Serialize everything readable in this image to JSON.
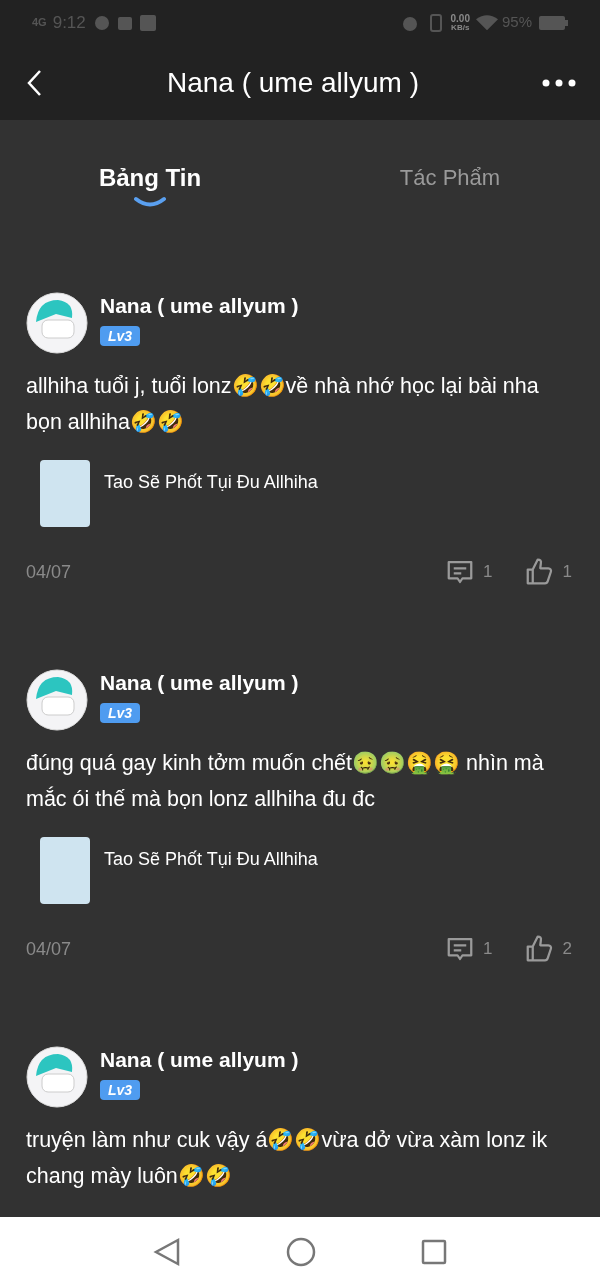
{
  "status_bar": {
    "network": "4G",
    "time": "9:12",
    "speed": "0.00",
    "speed_unit": "KB/s",
    "battery": "95%"
  },
  "header": {
    "title": "Nana ( ume allyum )"
  },
  "tabs": [
    {
      "label": "Bảng Tin",
      "selected": true
    },
    {
      "label": "Tác Phẩm",
      "selected": false
    }
  ],
  "posts": [
    {
      "author": "Nana ( ume allyum )",
      "level": "Lv3",
      "text": "allhiha tuổi j, tuổi lonz🤣🤣về nhà nhớ học lại bài nha bọn allhiha🤣🤣",
      "book": {
        "title": "Tao Sẽ Phốt Tụi Đu Allhiha"
      },
      "date": "04/07",
      "comments": "1",
      "likes": "1"
    },
    {
      "author": "Nana ( ume allyum )",
      "level": "Lv3",
      "text": "đúng quá gay kinh tởm muốn chết🤢🤢🤮🤮 nhìn mà mắc ói thế mà bọn lonz allhiha đu đc",
      "book": {
        "title": "Tao Sẽ Phốt Tụi Đu Allhiha"
      },
      "date": "04/07",
      "comments": "1",
      "likes": "2"
    },
    {
      "author": "Nana ( ume allyum )",
      "level": "Lv3",
      "text": "truyện làm như cuk vậy á🤣🤣vừa dở vừa xàm lonz ik chang mày luôn🤣🤣"
    }
  ]
}
